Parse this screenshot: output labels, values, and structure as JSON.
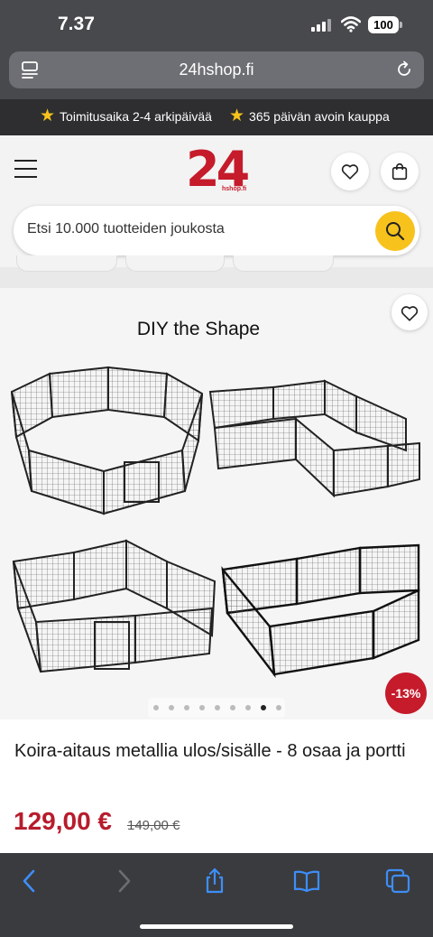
{
  "status_bar": {
    "time": "7.37",
    "battery": "100"
  },
  "browser": {
    "url": "24hshop.fi"
  },
  "promo": {
    "items": [
      {
        "icon": "star-icon",
        "text": "Toimitusaika 2-4 arkipäivää"
      },
      {
        "icon": "star-icon",
        "text": "365 päivän avoin kauppa"
      }
    ]
  },
  "header": {
    "logo_number": "24",
    "logo_sub": "hshop.fi",
    "search_placeholder": "Etsi 10.000 tuotteiden joukosta"
  },
  "product": {
    "image_caption": "DIY the Shape",
    "discount_badge": "-13%",
    "gallery_dots": 9,
    "active_dot": 8,
    "title": "Koira-aitaus metallia ulos/sisälle - 8 osaa ja portti",
    "price": "129,00 €",
    "old_price": "149,00 €"
  },
  "colors": {
    "brand_red": "#c51b2b",
    "price_red": "#b71c2c",
    "accent_yellow": "#f7c21c",
    "safari_blue": "#3d8ef8"
  }
}
